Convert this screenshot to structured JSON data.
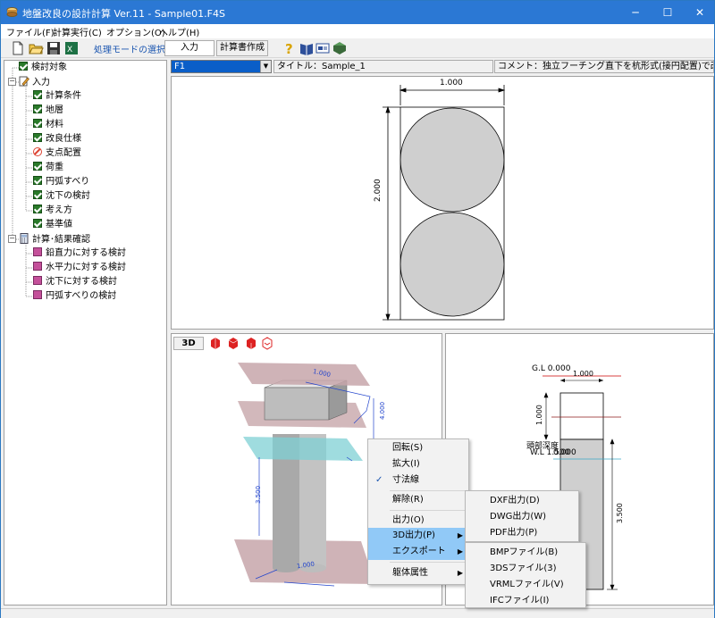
{
  "window": {
    "title": "地盤改良の設計計算 Ver.11 - Sample01.F4S",
    "minimize": "─",
    "maximize": "☐",
    "close": "✕"
  },
  "menubar": [
    "ファイル(F)",
    "計算実行(C)",
    "オプション(O)",
    "ヘルプ(H)"
  ],
  "toolbar": {
    "mode_label": "処理モードの選択",
    "input_button": "入力",
    "report_button": "計算書作成"
  },
  "tree": {
    "root1": "検討対象",
    "input_group": "入力",
    "input_items": [
      {
        "label": "計算条件",
        "state": "check"
      },
      {
        "label": "地層",
        "state": "check"
      },
      {
        "label": "材料",
        "state": "check"
      },
      {
        "label": "改良仕様",
        "state": "check"
      },
      {
        "label": "支点配置",
        "state": "none"
      },
      {
        "label": "荷重",
        "state": "check"
      },
      {
        "label": "円弧すべり",
        "state": "check"
      },
      {
        "label": "沈下の検討",
        "state": "check"
      },
      {
        "label": "考え方",
        "state": "check"
      },
      {
        "label": "基準値",
        "state": "check"
      }
    ],
    "result_group": "計算･結果確認",
    "result_items": [
      "鉛直力に対する検討",
      "水平力に対する検討",
      "沈下に対する検討",
      "円弧すべりの検討"
    ]
  },
  "top_pane": {
    "combo_value": "F1",
    "title_label": "タイトル：Sample_1",
    "comment_label": "コメント：独立フーチング直下を杭形式(接円配置)で改良(",
    "dim_width": "1.000",
    "dim_height": "2.000"
  },
  "pane3d": {
    "view_button": "3D",
    "dim_top": "1.000",
    "dim_side": "4.000",
    "dim_pile": "3.500",
    "dim_bottom": "1.000"
  },
  "side_pane": {
    "gl_label": "G.L 0.000",
    "dim_top": "1.000",
    "dim_depth_a": "1.000",
    "head_label": "頭部深度",
    "wl_label": "W.L 1.500",
    "head_value": "0.000",
    "dim_pile": "3.500"
  },
  "context_menu": {
    "items": [
      "回転(S)",
      "拡大(I)",
      "寸法線",
      "解除(R)",
      "出力(O)",
      "3D出力(P)",
      "エクスポート",
      "躯体属性"
    ],
    "checked_item": "寸法線",
    "submenu_3d": [
      "DXF出力(D)",
      "DWG出力(W)",
      "PDF出力(P)"
    ],
    "submenu_export": [
      "BMPファイル(B)",
      "3DSファイル(3)",
      "VRMLファイル(V)",
      "IFCファイル(I)"
    ]
  },
  "colors": {
    "titlebar": "#2b78d4",
    "menu_highlight": "#91c9f7",
    "pile_fill": "#cfcfcf",
    "plane_pink": "#c7a6aa",
    "plane_cyan": "#7fd0d4"
  }
}
